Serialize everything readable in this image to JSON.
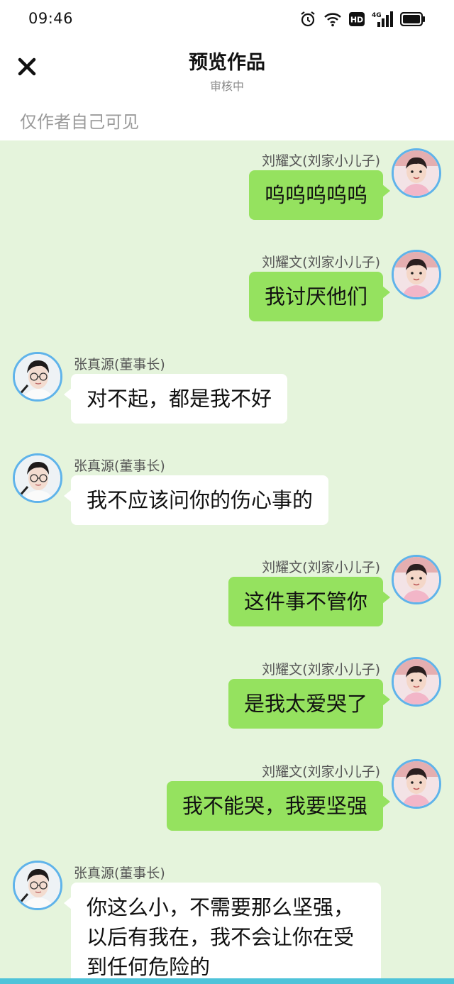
{
  "status_bar": {
    "time": "09:46",
    "icons": [
      "alarm-icon",
      "wifi-icon",
      "hd-icon",
      "signal-4g-icon",
      "battery-icon"
    ],
    "hd_label": "HD",
    "network_label": "4G"
  },
  "header": {
    "title": "预览作品",
    "subtitle": "审核中",
    "close_icon": "close-icon"
  },
  "visibility_note": "仅作者自己可见",
  "colors": {
    "chat_background": "#e5f4dc",
    "outgoing_bubble": "#95e25f",
    "incoming_bubble": "#ffffff",
    "avatar_border": "#5fb3ea"
  },
  "messages": [
    {
      "side": "right",
      "sender": "刘耀文(刘家小儿子)",
      "text": "呜呜呜呜呜"
    },
    {
      "side": "right",
      "sender": "刘耀文(刘家小儿子)",
      "text": "我讨厌他们"
    },
    {
      "side": "left",
      "sender": "张真源(董事长)",
      "text": "对不起，都是我不好"
    },
    {
      "side": "left",
      "sender": "张真源(董事长)",
      "text": "我不应该问你的伤心事的"
    },
    {
      "side": "right",
      "sender": "刘耀文(刘家小儿子)",
      "text": "这件事不管你"
    },
    {
      "side": "right",
      "sender": "刘耀文(刘家小儿子)",
      "text": "是我太爱哭了"
    },
    {
      "side": "right",
      "sender": "刘耀文(刘家小儿子)",
      "text": "我不能哭，我要坚强"
    },
    {
      "side": "left",
      "sender": "张真源(董事长)",
      "text": "你这么小，不需要那么坚强，以后有我在，我不会让你在受到任何危险的"
    }
  ]
}
